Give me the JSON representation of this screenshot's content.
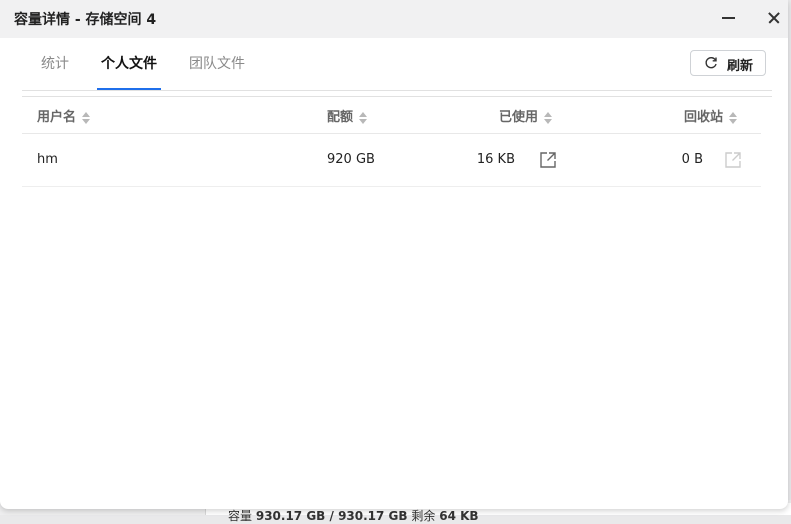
{
  "window": {
    "title": "容量详情 - 存储空间 4"
  },
  "tabs": [
    {
      "label": "统计",
      "active": false
    },
    {
      "label": "个人文件",
      "active": true
    },
    {
      "label": "团队文件",
      "active": false
    }
  ],
  "toolbar": {
    "refresh_label": "刷新"
  },
  "table": {
    "columns": [
      "用户名",
      "配额",
      "已使用",
      "回收站"
    ],
    "rows": [
      {
        "user": "hm",
        "quota": "920 GB",
        "used": "16 KB",
        "recycle": "0 B"
      }
    ]
  },
  "background": {
    "text_prefix": "容量",
    "text_value": "930.17 GB / 930.17 GB",
    "text_remain_label": "剩余",
    "text_remain_value": "64 KB"
  },
  "colors": {
    "accent": "#1f6feb",
    "header_text": "#666666",
    "muted_icon": "#cccccc"
  }
}
